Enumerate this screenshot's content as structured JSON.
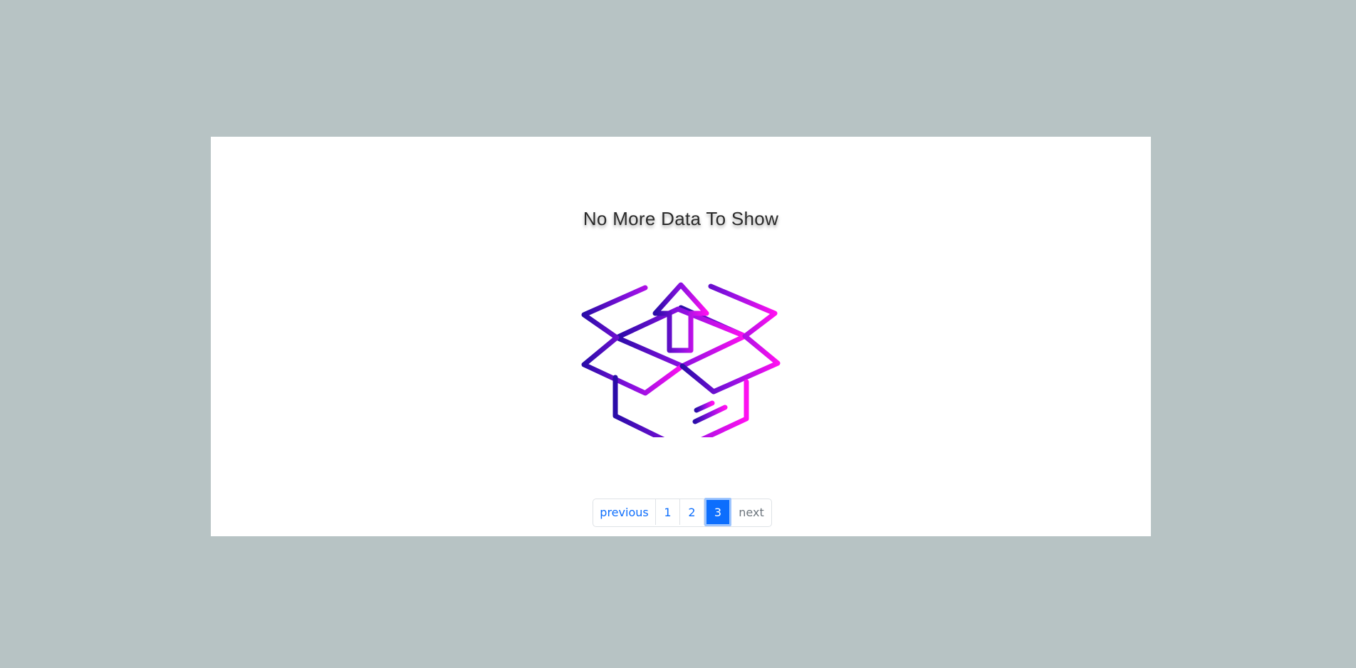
{
  "empty_state": {
    "message": "No More Data To Show",
    "illustration": "open-box-upload-icon",
    "gradient": [
      "#2a0ca8",
      "#8a10e0",
      "#ff10f0"
    ]
  },
  "pagination": {
    "previous_label": "previous",
    "pages": [
      "1",
      "2",
      "3"
    ],
    "current_page": "3",
    "next_label": "next"
  },
  "colors": {
    "background": "#b7c3c4",
    "card": "#ffffff",
    "accent": "#0d6efd",
    "disabled": "#6c757d"
  }
}
